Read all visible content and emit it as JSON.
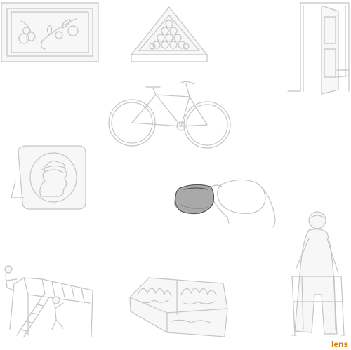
{
  "caption": {
    "text": "lens"
  },
  "colors": {
    "line": "#c4c4c4",
    "fill": "#f7f7f7",
    "highlight_fill": "#a9a9a9",
    "highlight_line": "#555555",
    "caption": "#e07b00"
  },
  "objects": [
    "framed-picture",
    "billiard-rack",
    "open-door",
    "bicycle",
    "photo-frame",
    "sunglasses",
    "elderly-person-with-walker",
    "climbing-frame",
    "planter-box"
  ],
  "highlighted_part": "sunglasses-left-lens"
}
